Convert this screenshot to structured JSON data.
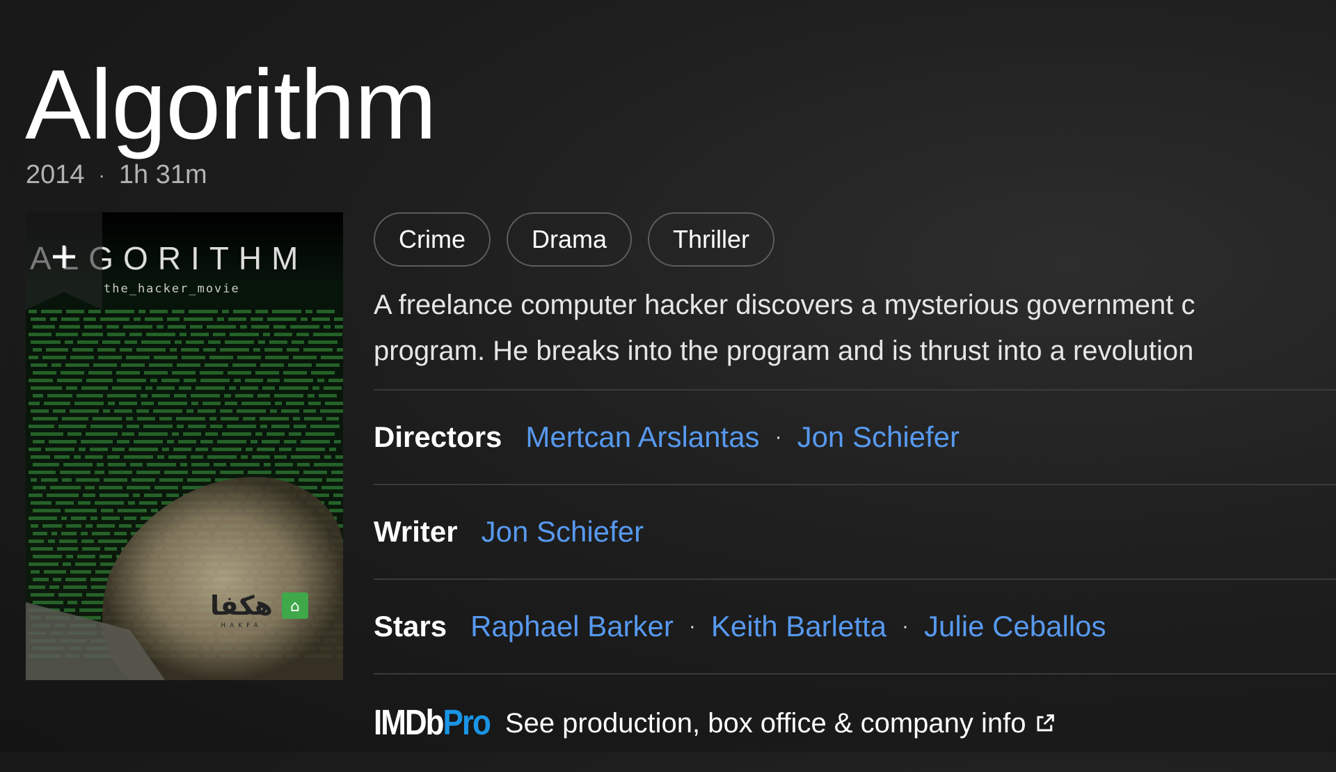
{
  "title": "Algorithm",
  "meta": {
    "year": "2014",
    "runtime": "1h 31m"
  },
  "poster": {
    "title_text": "ALGORITHM",
    "tagline": "the_hacker_movie",
    "watermark_text": "هكفا",
    "watermark_sub": "HAKFA",
    "watchlist_symbol": "+"
  },
  "genres": [
    "Crime",
    "Drama",
    "Thriller"
  ],
  "plot": {
    "line1": "A freelance computer hacker discovers a mysterious government c",
    "line2": "program. He breaks into the program and is thrust into a revolution"
  },
  "credits": {
    "directors_label": "Directors",
    "directors": [
      "Mertcan Arslantas",
      "Jon Schiefer"
    ],
    "writer_label": "Writer",
    "writers": [
      "Jon Schiefer"
    ],
    "stars_label": "Stars",
    "stars": [
      "Raphael Barker",
      "Keith Barletta",
      "Julie Ceballos"
    ]
  },
  "imdbpro": {
    "logo_imdb": "IMDb",
    "logo_pro": "Pro",
    "link_text": "See production, box office & company info"
  },
  "colors": {
    "link": "#5799ef",
    "pro": "#1a95e6",
    "background": "#1e1e1e"
  }
}
